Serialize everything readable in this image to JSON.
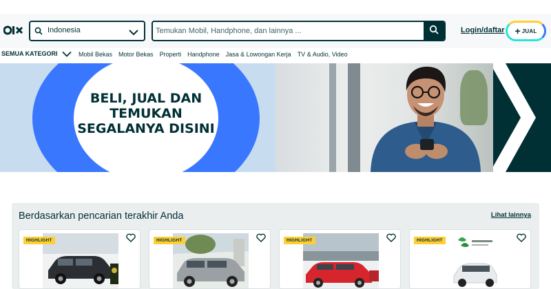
{
  "header": {
    "logo_text": "OLX",
    "location": {
      "value": "Indonesia",
      "icon": "search-icon",
      "dropdown_icon": "chevron-down-icon"
    },
    "search": {
      "placeholder": "Temukan Mobil, Handphone, dan lainnya ...",
      "button_icon": "search-icon"
    },
    "login_label": "Login/daftar",
    "sell_label": "JUAL",
    "sell_icon": "plus-icon"
  },
  "categories": {
    "all_label": "SEMUA KATEGORI",
    "items": [
      {
        "label": "Mobil Bekas"
      },
      {
        "label": "Motor Bekas"
      },
      {
        "label": "Properti"
      },
      {
        "label": "Handphone"
      },
      {
        "label": "Jasa & Lowongan Kerja"
      },
      {
        "label": "TV & Audio, Video"
      }
    ]
  },
  "banner": {
    "headline_lines": [
      "BELI, JUAL DAN",
      "TEMUKAN",
      "SEGALANYA DISINI"
    ]
  },
  "recent": {
    "title": "Berdasarkan pencarian terakhir Anda",
    "see_more_label": "Lihat lainnya",
    "cards": [
      {
        "badge": "HIGHLIGHT",
        "heart_icon": "heart-icon",
        "car_color": "#2b2f33"
      },
      {
        "badge": "HIGHLIGHT",
        "heart_icon": "heart-icon",
        "car_color": "#9aa0a4"
      },
      {
        "badge": "HIGHLIGHT",
        "heart_icon": "heart-icon",
        "car_color": "#d7252d"
      },
      {
        "badge": "HIGHLIGHT",
        "heart_icon": "heart-icon",
        "car_color": "#e9ecee"
      }
    ]
  },
  "colors": {
    "brand": "#002f34",
    "accent_blue": "#3a77ff",
    "accent_teal": "#23e5db",
    "accent_yellow": "#ffce32"
  }
}
